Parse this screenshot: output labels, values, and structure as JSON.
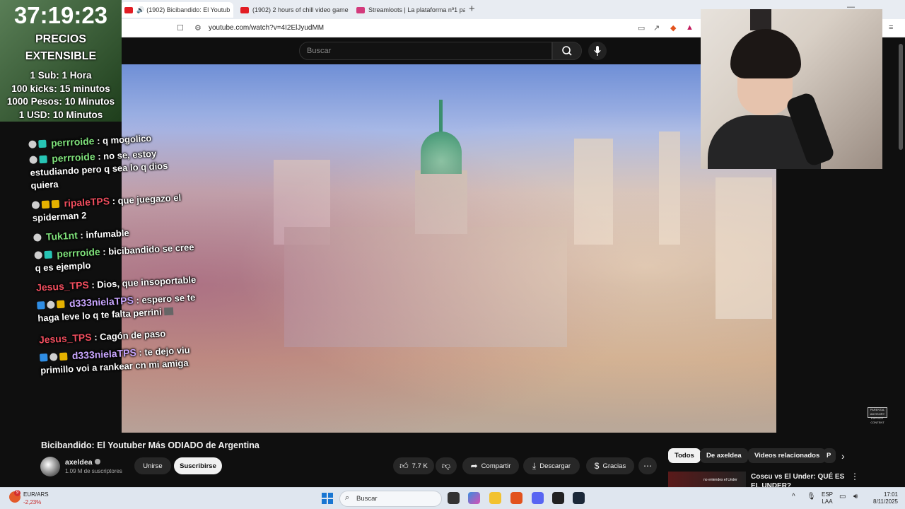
{
  "browser": {
    "tabs": [
      {
        "title": "(1902) Bicibandido: El Youtub",
        "active": true
      },
      {
        "title": "(1902) 2 hours of chill video game m",
        "active": false
      },
      {
        "title": "Streamloots | La plataforma nº1 para",
        "active": false
      }
    ],
    "url": "youtube.com/watch?v=4I2ElJyudMM"
  },
  "youtube": {
    "search_placeholder": "Buscar",
    "video_title": "Bicibandido: El Youtuber Más ODIADO de Argentina",
    "channel": "axeldea",
    "subscribers": "1.09 M de suscriptores",
    "join_label": "Unirse",
    "subscribe_label": "Suscribirse",
    "likes": "7.7 K",
    "share_label": "Compartir",
    "download_label": "Descargar",
    "thanks_label": "Gracias",
    "chips": [
      "Todos",
      "De axeldea",
      "Videos relacionados",
      "P"
    ],
    "related": {
      "title": "Coscu vs El Under: QUÉ ES EL UNDER?",
      "thumb_text": "no entendes el Under"
    },
    "explicit_label": "PARENTAL ADVISORY EXPLICIT CONTENT"
  },
  "overlay": {
    "timer": "37:19:23",
    "pricing_title": "PRECIOS",
    "pricing_subtitle": "EXTENSIBLE",
    "price_lines": [
      "1 Sub: 1 Hora",
      "100 kicks: 15 minutos",
      "1000 Pesos: 10 Minutos",
      "1 USD: 10 Minutos"
    ]
  },
  "chat": [
    {
      "user": "perrroide",
      "color": "#7ee07a",
      "text": ": q mogolico"
    },
    {
      "user": "perrroide",
      "color": "#7ee07a",
      "text": ": no se, estoy estudiando pero q sea lo q dios quiera"
    },
    {
      "user": "ripaleTPS",
      "color": "#f04e5e",
      "text": ": que juegazo el spiderman 2"
    },
    {
      "user": "Tuk1nt",
      "color": "#7ee07a",
      "text": ": infumable"
    },
    {
      "user": "perrroide",
      "color": "#7ee07a",
      "text": ": bicibandido se cree q es ejemplo"
    },
    {
      "user": "Jesus_TPS",
      "color": "#f04e5e",
      "text": ": Dios, que insoportable"
    },
    {
      "user": "d333nielaTPS",
      "color": "#c9a6ff",
      "text": ": espero se te haga leve lo q te falta perrini"
    },
    {
      "user": "Jesus_TPS",
      "color": "#f04e5e",
      "text": ": Cagón de paso"
    },
    {
      "user": "d333nielaTPS",
      "color": "#c9a6ff",
      "text": ": te dejo viu primillo voi a rankear cn mi amiga"
    }
  ],
  "taskbar": {
    "weather_badge": "9",
    "stock_name": "EUR/ARS",
    "stock_change": "-2,23%",
    "search_label": "Buscar",
    "lang": "ESP",
    "layout": "LAA",
    "time": "17:01",
    "date": "8/11/2025"
  },
  "icons": [
    "search-icon",
    "mic-icon",
    "like-icon",
    "dislike-icon",
    "share-icon",
    "download-icon",
    "thanks-icon",
    "more-icon",
    "chevron-right-icon",
    "bookmark-icon",
    "windows-start-icon"
  ]
}
